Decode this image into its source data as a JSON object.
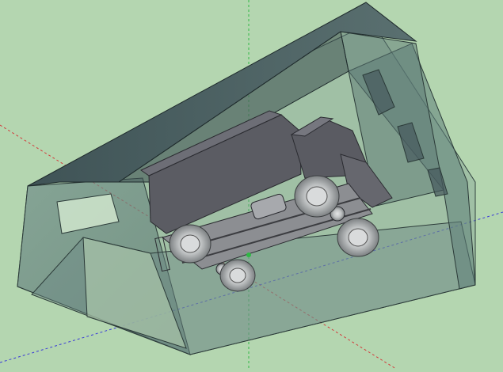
{
  "viewport": {
    "background_color": "#b4d6b0",
    "axes": {
      "red_axis_color": "#d23c3c",
      "green_axis_color": "#2fb844",
      "blue_axis_color": "#3a3ad8"
    },
    "model": {
      "building_tint": "#5f7f7a",
      "roof_color": "#46595c",
      "truck_color": "#5b5c63",
      "wheel_color": "#b9bcbd"
    }
  }
}
